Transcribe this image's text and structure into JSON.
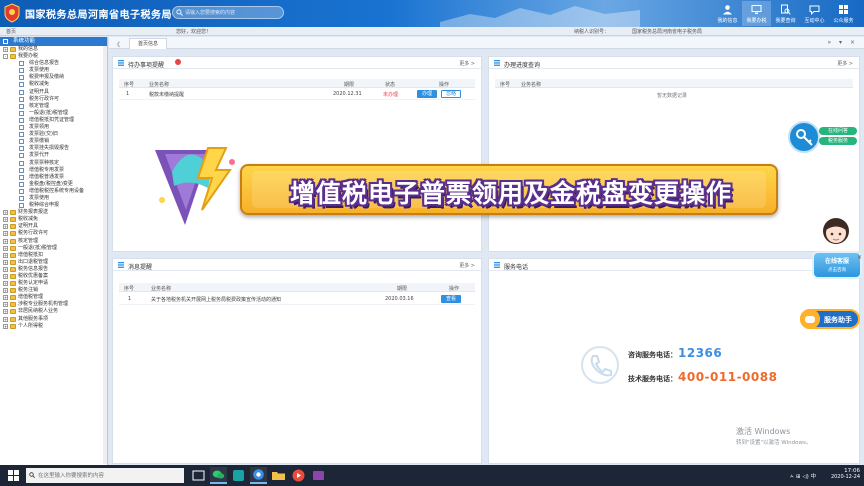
{
  "header": {
    "title": "国家税务总局河南省电子税务局",
    "logo_text": "中国税务",
    "search_placeholder": "请输入您要搜索的内容",
    "actions": [
      {
        "label": "我的信息",
        "icon": "user-icon"
      },
      {
        "label": "我要办税",
        "icon": "monitor-icon"
      },
      {
        "label": "我要查询",
        "icon": "search-doc-icon"
      },
      {
        "label": "互动中心",
        "icon": "chat-icon"
      },
      {
        "label": "公众服务",
        "icon": "grid-icon"
      }
    ]
  },
  "subbar": {
    "left": "首页",
    "mid": "您好，欢迎您！",
    "right1": "纳税人识别号：",
    "right2": "国家税务总局河南省电子税务局"
  },
  "sidebar": {
    "title": "系统功能",
    "items": [
      {
        "label": "我的信息",
        "level": 0,
        "kind": "folder-plus"
      },
      {
        "label": "我要办税",
        "level": 0,
        "kind": "folder-minus"
      },
      {
        "label": "综合信息报告",
        "level": 1,
        "kind": "doc"
      },
      {
        "label": "发票使用",
        "level": 1,
        "kind": "doc"
      },
      {
        "label": "税费申报及缴纳",
        "level": 1,
        "kind": "doc"
      },
      {
        "label": "税收减免",
        "level": 1,
        "kind": "doc"
      },
      {
        "label": "证明开具",
        "level": 1,
        "kind": "doc"
      },
      {
        "label": "税务行政许可",
        "level": 1,
        "kind": "doc"
      },
      {
        "label": "核定管理",
        "level": 1,
        "kind": "doc"
      },
      {
        "label": "一般退(抵)税管理",
        "level": 1,
        "kind": "doc"
      },
      {
        "label": "增值税抵扣凭证管理",
        "level": 1,
        "kind": "doc"
      },
      {
        "label": "发票领用",
        "level": 1,
        "kind": "doc"
      },
      {
        "label": "发票验(交)旧",
        "level": 1,
        "kind": "doc"
      },
      {
        "label": "发票缴销",
        "level": 1,
        "kind": "doc"
      },
      {
        "label": "发票挂失损毁报告",
        "level": 1,
        "kind": "doc"
      },
      {
        "label": "发票代开",
        "level": 1,
        "kind": "doc"
      },
      {
        "label": "发票票种核定",
        "level": 1,
        "kind": "doc"
      },
      {
        "label": "增值税专用发票",
        "level": 1,
        "kind": "doc"
      },
      {
        "label": "增值税普通发票",
        "level": 1,
        "kind": "doc"
      },
      {
        "label": "金税盘(税控盘)变更",
        "level": 1,
        "kind": "doc"
      },
      {
        "label": "增值税税控系统专用设备",
        "level": 1,
        "kind": "doc"
      },
      {
        "label": "发票使用",
        "level": 1,
        "kind": "doc"
      },
      {
        "label": "税种综合申报",
        "level": 1,
        "kind": "doc"
      },
      {
        "label": "财务报表报送",
        "level": 0,
        "kind": "folder-plus"
      },
      {
        "label": "税收减免",
        "level": 0,
        "kind": "folder-plus"
      },
      {
        "label": "证明开具",
        "level": 0,
        "kind": "folder-plus"
      },
      {
        "label": "税务行政许可",
        "level": 0,
        "kind": "folder-plus"
      },
      {
        "label": "核定管理",
        "level": 0,
        "kind": "folder-plus"
      },
      {
        "label": "一般退(抵)税管理",
        "level": 0,
        "kind": "folder-plus"
      },
      {
        "label": "增值税抵扣",
        "level": 0,
        "kind": "folder-plus"
      },
      {
        "label": "出口退税管理",
        "level": 0,
        "kind": "folder-plus"
      },
      {
        "label": "税务信息报告",
        "level": 0,
        "kind": "folder-plus"
      },
      {
        "label": "税收优惠备案",
        "level": 0,
        "kind": "folder-plus"
      },
      {
        "label": "税务认定申请",
        "level": 0,
        "kind": "folder-plus"
      },
      {
        "label": "税务注销",
        "level": 0,
        "kind": "folder-plus"
      },
      {
        "label": "增值税管理",
        "level": 0,
        "kind": "folder-plus"
      },
      {
        "label": "涉税专业服务机构管理",
        "level": 0,
        "kind": "folder-plus"
      },
      {
        "label": "非居民纳税人业务",
        "level": 0,
        "kind": "folder-plus"
      },
      {
        "label": "其他服务事项",
        "level": 0,
        "kind": "folder-plus"
      },
      {
        "label": "个人所得税",
        "level": 0,
        "kind": "folder-plus"
      }
    ]
  },
  "tabs": {
    "nav": "《",
    "active": "首页信息",
    "tools": "» ▾ ×"
  },
  "todo_panel": {
    "title": "待办事项提醒",
    "more": "更多 >",
    "columns": [
      "序号",
      "业务名称",
      "期限",
      "状态",
      "操作"
    ],
    "rows": [
      {
        "no": "1",
        "name": "税款未缴纳提醒",
        "deadline": "2020.12.31",
        "status": "未办理",
        "btn1": "办理",
        "btn2": "忽略"
      }
    ]
  },
  "apply_panel": {
    "title": "办理进度查询",
    "more": "更多 >",
    "columns": [
      "序号",
      "业务名称"
    ],
    "empty": "暂无数据记录"
  },
  "notice_panel": {
    "title": "消息提醒",
    "more": "更多 >",
    "columns": [
      "序号",
      "业务名称",
      "期限",
      "操作"
    ],
    "rows": [
      {
        "no": "1",
        "name": "关于各地税务机关开展网上税务局税费政策宣传活动的通知",
        "deadline": "2020.03.16",
        "btn": "查看"
      }
    ]
  },
  "phone_panel": {
    "title": "服务电话",
    "service_label": "咨询服务电话：",
    "service_number": "12366",
    "tech_label": "技术服务电话：",
    "tech_number": "400-011-0088"
  },
  "banner": {
    "text": "增值税电子普票领用及金税盘变更操作"
  },
  "floating": {
    "links": [
      "在线问答",
      "税务服务"
    ],
    "online": "在线客服",
    "online_sub": "点击咨询",
    "service": "服务助手",
    "close": "×"
  },
  "watermark": {
    "line1": "激活 Windows",
    "line2": "转到\"设置\"以激活 Windows。"
  },
  "taskbar": {
    "search_placeholder": "在这里输入你要搜索的内容",
    "time": "17:06",
    "date": "2020-12-24",
    "tray_text": "ㅅ  ⊞  ◁)  中"
  },
  "colors": {
    "brand_blue": "#1a73d1",
    "action_blue": "#2f8fe0",
    "warn_red": "#e8454b",
    "banner_gold": "#f7b02a",
    "phone_orange": "#f06a2b",
    "phone_blue": "#3a8fe2"
  }
}
